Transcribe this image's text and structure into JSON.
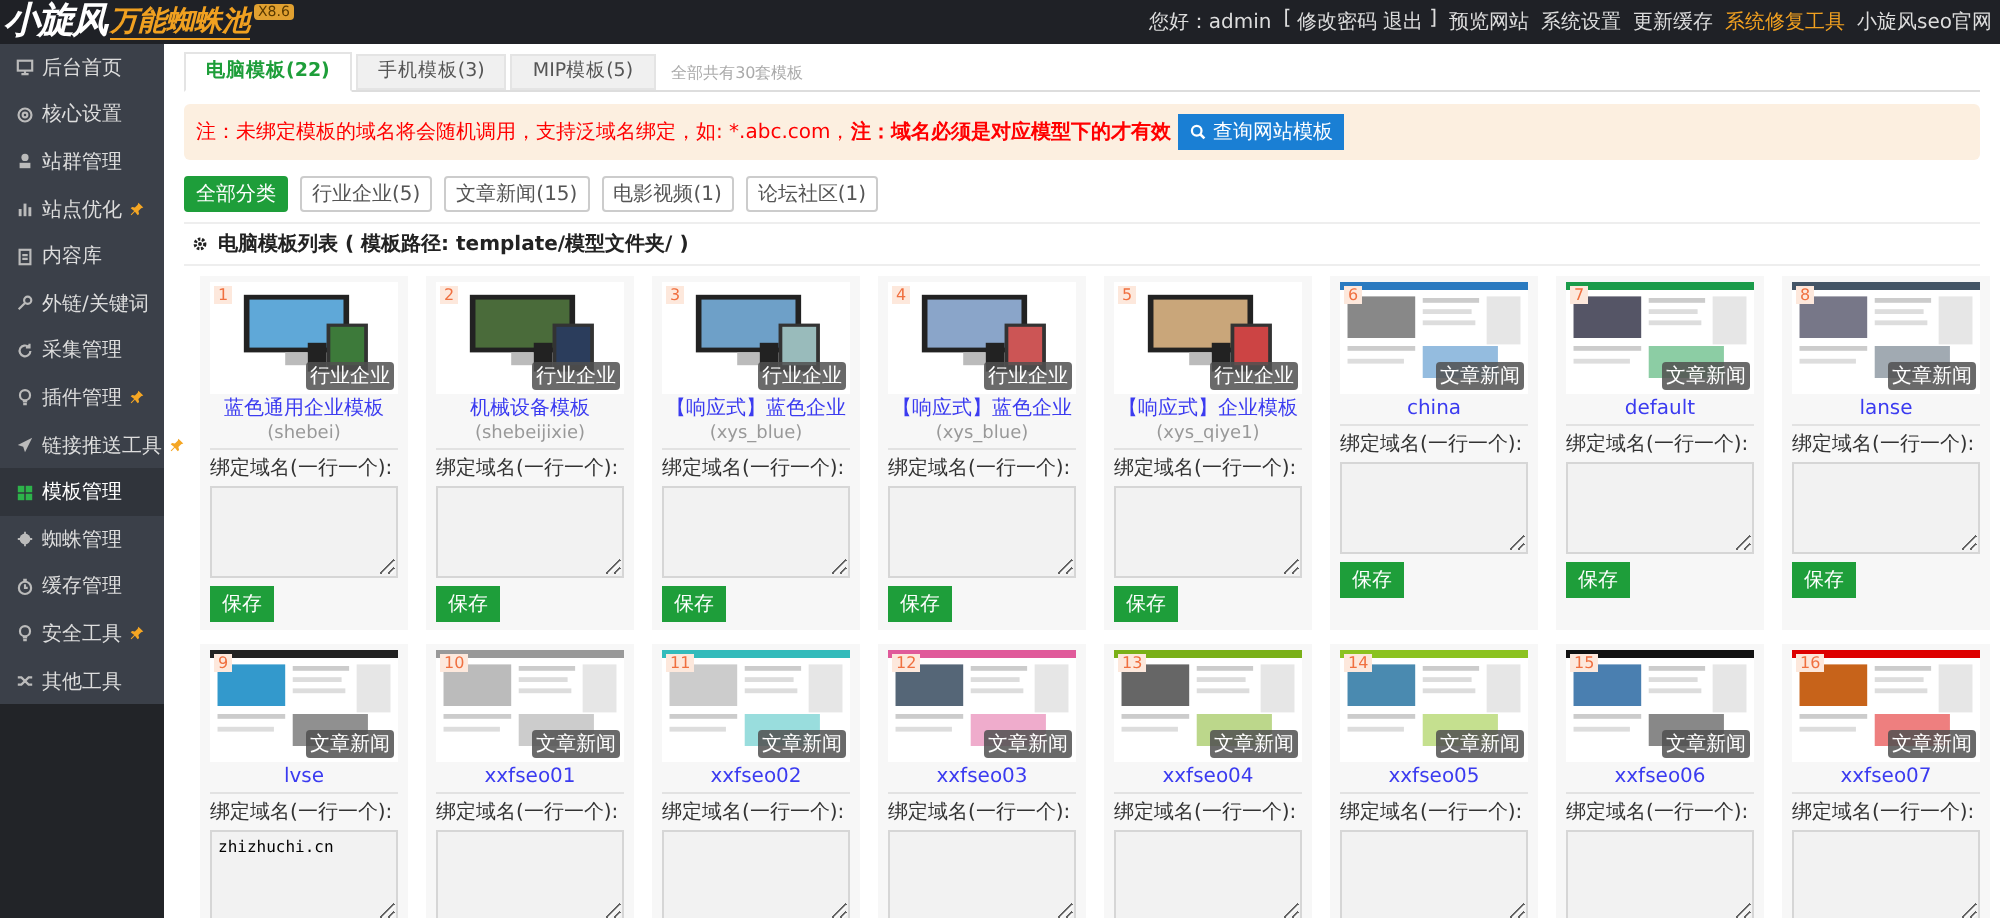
{
  "header": {
    "logo_main": "小旋风",
    "logo_sub": "万能蜘蛛池",
    "version": "X8.6",
    "greeting": "您好：admin",
    "bracket_open": "[",
    "account_links": [
      "修改密码",
      "退出"
    ],
    "bracket_close": "]",
    "nav_links": [
      {
        "label": "预览网站",
        "highlighted": false
      },
      {
        "label": "系统设置",
        "highlighted": false
      },
      {
        "label": "更新缓存",
        "highlighted": false
      },
      {
        "label": "系统修复工具",
        "highlighted": true
      },
      {
        "label": "小旋风seo官网",
        "highlighted": false
      }
    ]
  },
  "sidebar": {
    "items": [
      {
        "label": "后台首页",
        "selected": false,
        "pinned": false
      },
      {
        "label": "核心设置",
        "selected": false,
        "pinned": false
      },
      {
        "label": "站群管理",
        "selected": false,
        "pinned": false
      },
      {
        "label": "站点优化",
        "selected": false,
        "pinned": true
      },
      {
        "label": "内容库",
        "selected": false,
        "pinned": false
      },
      {
        "label": "外链/关键词",
        "selected": false,
        "pinned": false
      },
      {
        "label": "采集管理",
        "selected": false,
        "pinned": false
      },
      {
        "label": "插件管理",
        "selected": false,
        "pinned": true
      },
      {
        "label": "链接推送工具",
        "selected": false,
        "pinned": true
      },
      {
        "label": "模板管理",
        "selected": true,
        "pinned": false
      },
      {
        "label": "蜘蛛管理",
        "selected": false,
        "pinned": false
      },
      {
        "label": "缓存管理",
        "selected": false,
        "pinned": false
      },
      {
        "label": "安全工具",
        "selected": false,
        "pinned": true
      },
      {
        "label": "其他工具",
        "selected": false,
        "pinned": false
      }
    ]
  },
  "tabs": [
    {
      "label": "电脑模板(22)",
      "selected": true
    },
    {
      "label": "手机模板(3)",
      "selected": false
    },
    {
      "label": "MIP模板(5)",
      "selected": false
    }
  ],
  "tab_note": "全部共有30套模板",
  "notice": {
    "text": "注：未绑定模板的域名将会随机调用，支持泛域名绑定，如: *.abc.com，**注：域名必须是对应模型下的才有效**",
    "button": "查询网站模板"
  },
  "filters": [
    {
      "label": "全部分类",
      "selected": true
    },
    {
      "label": "行业企业(5)",
      "selected": false
    },
    {
      "label": "文章新闻(15)",
      "selected": false
    },
    {
      "label": "电影视频(1)",
      "selected": false
    },
    {
      "label": "论坛社区(1)",
      "selected": false
    }
  ],
  "section_title": "电脑模板列表 ( **模板路径: template/模型文件夹/** )",
  "templates": [
    {
      "number": "1",
      "category": "行业企业",
      "name": "蓝色通用企业模板",
      "slug": "(shebei)",
      "field_label": "绑定域名(一行一个):",
      "button": "保存"
    },
    {
      "number": "2",
      "category": "行业企业",
      "name": "机械设备模板",
      "slug": "(shebeijixie)",
      "field_label": "绑定域名(一行一个):",
      "button": "保存"
    },
    {
      "number": "3",
      "category": "行业企业",
      "name": "【响应式】蓝色企业",
      "slug": "(xys_blue)",
      "field_label": "绑定域名(一行一个):",
      "button": "保存"
    },
    {
      "number": "4",
      "category": "行业企业",
      "name": "【响应式】蓝色企业",
      "slug": "(xys_blue)",
      "field_label": "绑定域名(一行一个):",
      "button": "保存"
    },
    {
      "number": "5",
      "category": "行业企业",
      "name": "【响应式】企业模板",
      "slug": "(xys_qiye1)",
      "field_label": "绑定域名(一行一个):",
      "button": "保存"
    },
    {
      "number": "6",
      "category": "文章新闻",
      "name": "china",
      "field_label": "绑定域名(一行一个):",
      "button": "保存"
    },
    {
      "number": "7",
      "category": "文章新闻",
      "name": "default",
      "field_label": "绑定域名(一行一个):",
      "button": "保存"
    },
    {
      "number": "8",
      "category": "文章新闻",
      "name": "lanse",
      "field_label": "绑定域名(一行一个):",
      "button": "保存"
    },
    {
      "number": "9",
      "category": "文章新闻",
      "name": "lvse",
      "field_label": "绑定域名(一行一个):",
      "value": "zhizhuchi.cn"
    },
    {
      "number": "10",
      "category": "文章新闻",
      "name": "xxfseo01",
      "field_label": "绑定域名(一行一个):"
    },
    {
      "number": "11",
      "category": "文章新闻",
      "name": "xxfseo02",
      "field_label": "绑定域名(一行一个):"
    },
    {
      "number": "12",
      "category": "文章新闻",
      "name": "xxfseo03",
      "field_label": "绑定域名(一行一个):"
    },
    {
      "number": "13",
      "category": "文章新闻",
      "name": "xxfseo04",
      "field_label": "绑定域名(一行一个):"
    },
    {
      "number": "14",
      "category": "文章新闻",
      "name": "xxfseo05",
      "field_label": "绑定域名(一行一个):"
    },
    {
      "number": "15",
      "category": "文章新闻",
      "name": "xxfseo06",
      "field_label": "绑定域名(一行一个):"
    },
    {
      "number": "16",
      "category": "文章新闻",
      "name": "xxfseo07",
      "field_label": "绑定域名(一行一个):"
    }
  ]
}
